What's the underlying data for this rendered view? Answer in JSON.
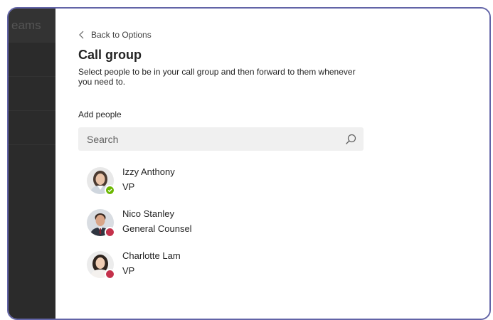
{
  "app": {
    "rail_title": "eams"
  },
  "panel": {
    "back_label": "Back to Options",
    "title": "Call group",
    "description": "Select people to be in your call group and then forward to them whenever you need to.",
    "add_people_label": "Add people"
  },
  "search": {
    "placeholder": "Search",
    "icon": "search-icon"
  },
  "people": [
    {
      "name": "Izzy Anthony",
      "role": "VP",
      "presence": "available",
      "presence_color": "#6bb700"
    },
    {
      "name": "Nico Stanley",
      "role": "General Counsel",
      "presence": "busy",
      "presence_color": "#c4314b"
    },
    {
      "name": "Charlotte Lam",
      "role": "VP",
      "presence": "busy",
      "presence_color": "#c4314b"
    }
  ],
  "colors": {
    "frame": "#6264a7",
    "rail": "#2b2b2b",
    "search_bg": "#f0f0f0",
    "available": "#6bb700",
    "busy": "#c4314b"
  }
}
